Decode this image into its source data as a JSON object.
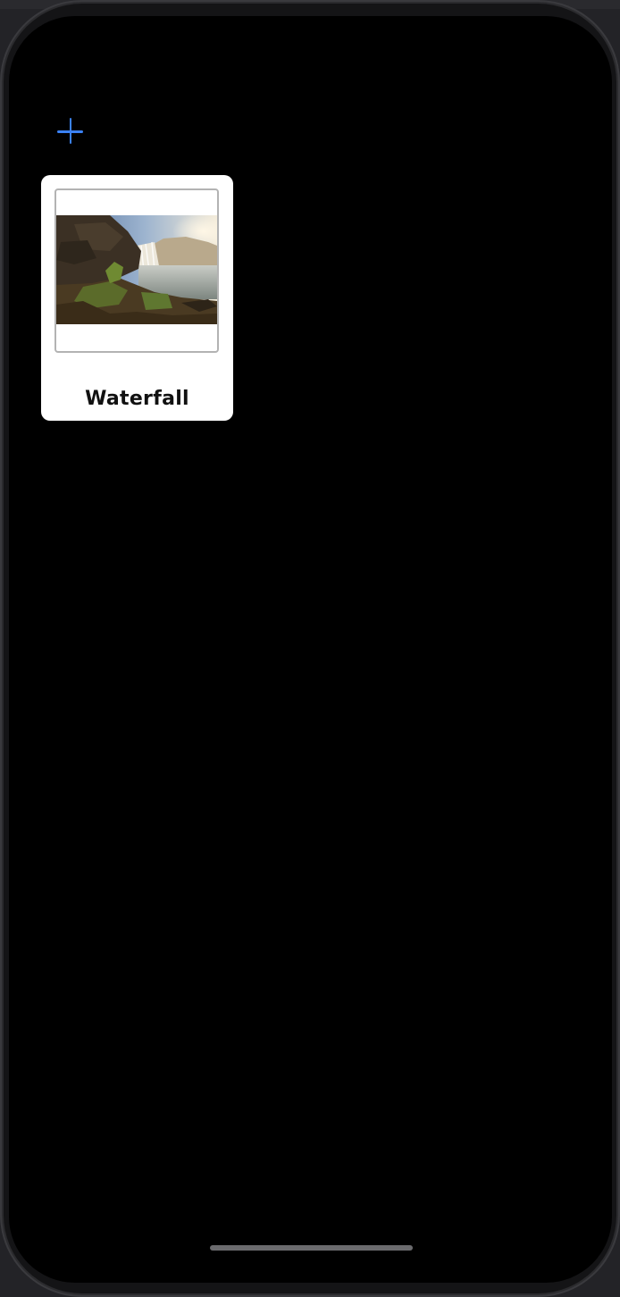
{
  "toolbar": {
    "add_icon": "plus-icon",
    "accent_color": "#3b82f6"
  },
  "albums": [
    {
      "title": "Waterfall",
      "thumbnail": "waterfall-landscape-photo"
    }
  ]
}
